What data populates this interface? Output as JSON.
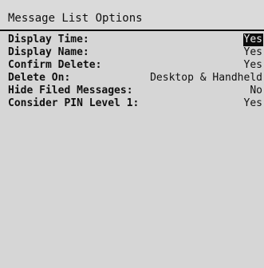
{
  "screen": {
    "title": "Message List Options"
  },
  "options": [
    {
      "label": "Display Time:",
      "value": "Yes",
      "selected": true
    },
    {
      "label": "Display Name:",
      "value": "Yes",
      "selected": false
    },
    {
      "label": "Confirm Delete:",
      "value": "Yes",
      "selected": false
    },
    {
      "label": "Delete On:",
      "value": "Desktop & Handheld",
      "selected": false
    },
    {
      "label": "Hide Filed Messages:",
      "value": "No",
      "selected": false
    },
    {
      "label": "Consider PIN Level 1:",
      "value": "Yes",
      "selected": false
    }
  ],
  "colors": {
    "background": "#d6d6d6",
    "selection_background": "#0c0c0c",
    "selection_text": "#f0f0f0",
    "text": "#101010"
  }
}
